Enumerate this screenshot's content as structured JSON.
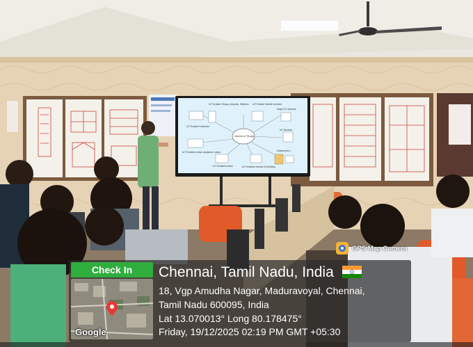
{
  "photo": {
    "screen_labels": [
      "IoT Enable Shops, Airports, Stations",
      "IoT Enable Mobile devices",
      "IoT Enable Factories",
      "Edge IoT devices",
      "Internet of Things",
      "IoT devices",
      "IoT Enabled ships airplanes, trains",
      "IoT Enabled cities",
      "IoT enabled homes & building",
      "Datacenters"
    ]
  },
  "overlay": {
    "brand": "GPS Map Camera",
    "check_in": "Check In",
    "map_watermark": "Google",
    "location_title": "Chennai, Tamil Nadu, India",
    "address_line1": "18, Vgp Amudha Nagar, Maduravoyal, Chennai,",
    "address_line2": "Tamil Nadu 600095, India",
    "coordinates": "Lat 13.070013° Long 80.178475°",
    "datetime": "Friday, 19/12/2025 02:19 PM GMT +05:30",
    "flag_icon": "india-flag-icon",
    "colors": {
      "check_in_bg": "#2fae3d",
      "card_bg": "#2d2d2d"
    }
  }
}
